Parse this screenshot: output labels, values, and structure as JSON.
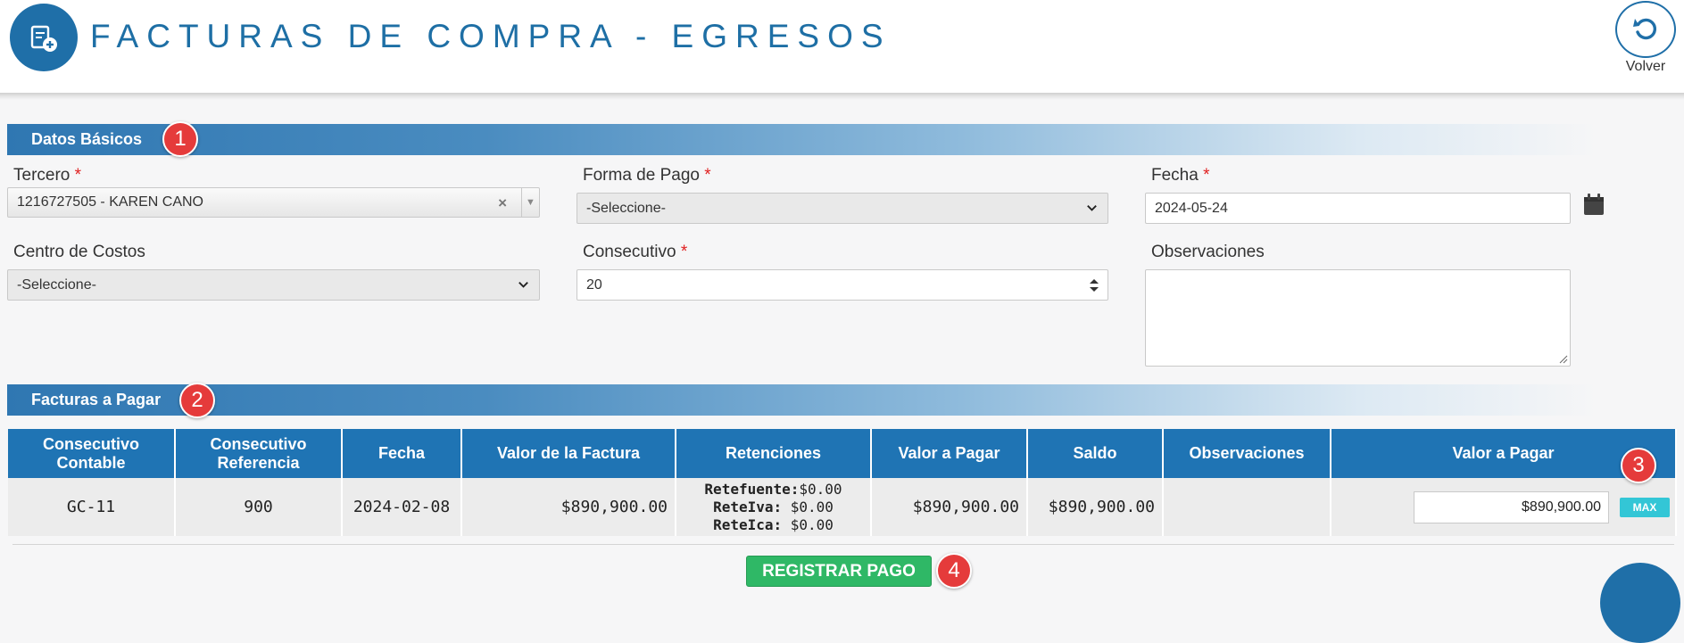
{
  "header": {
    "title": "FACTURAS DE COMPRA - EGRESOS",
    "logo_icon": "invoice-add-icon",
    "back_label": "Volver",
    "back_icon": "undo-icon"
  },
  "sections": {
    "basic": {
      "title": "Datos Básicos",
      "badge": "1"
    },
    "invoices": {
      "title": "Facturas a Pagar",
      "badge": "2"
    }
  },
  "form": {
    "tercero": {
      "label": "Tercero",
      "required": "*",
      "value": "1216727505 - KAREN CANO"
    },
    "forma_pago": {
      "label": "Forma de Pago",
      "required": "*",
      "value": "-Seleccione-"
    },
    "fecha": {
      "label": "Fecha",
      "required": "*",
      "value": "2024-05-24"
    },
    "centro_costos": {
      "label": "Centro de Costos",
      "value": "-Seleccione-"
    },
    "consecutivo": {
      "label": "Consecutivo",
      "required": "*",
      "value": "20"
    },
    "observaciones": {
      "label": "Observaciones",
      "value": ""
    }
  },
  "table": {
    "headers": {
      "consecutivo_contable": "Consecutivo Contable",
      "consecutivo_referencia": "Consecutivo Referencia",
      "fecha": "Fecha",
      "valor_factura": "Valor de la Factura",
      "retenciones": "Retenciones",
      "valor_pagar": "Valor a Pagar",
      "saldo": "Saldo",
      "observaciones": "Observaciones",
      "valor_pagar_input": "Valor a Pagar"
    },
    "rows": [
      {
        "consecutivo_contable": "GC-11",
        "consecutivo_referencia": "900",
        "fecha": "2024-02-08",
        "valor_factura": "$890,900.00",
        "retefuente_label": "Retefuente:",
        "retefuente_value": "$0.00",
        "reteiva_label": "ReteIva:",
        "reteiva_value": " $0.00",
        "reteica_label": "ReteIca:",
        "reteica_value": " $0.00",
        "valor_pagar": "$890,900.00",
        "saldo": "$890,900.00",
        "observaciones": "",
        "pago_input": "$890,900.00",
        "max_label": "MAX",
        "max_badge": "3"
      }
    ]
  },
  "actions": {
    "submit_label": "REGISTRAR PAGO",
    "submit_badge": "4"
  },
  "colors": {
    "primary": "#1f6fa8",
    "table_header": "#1f74b4",
    "submit": "#2fb866",
    "max_button": "#33c6d6",
    "badge": "#e53b3b",
    "required": "#e02020"
  }
}
